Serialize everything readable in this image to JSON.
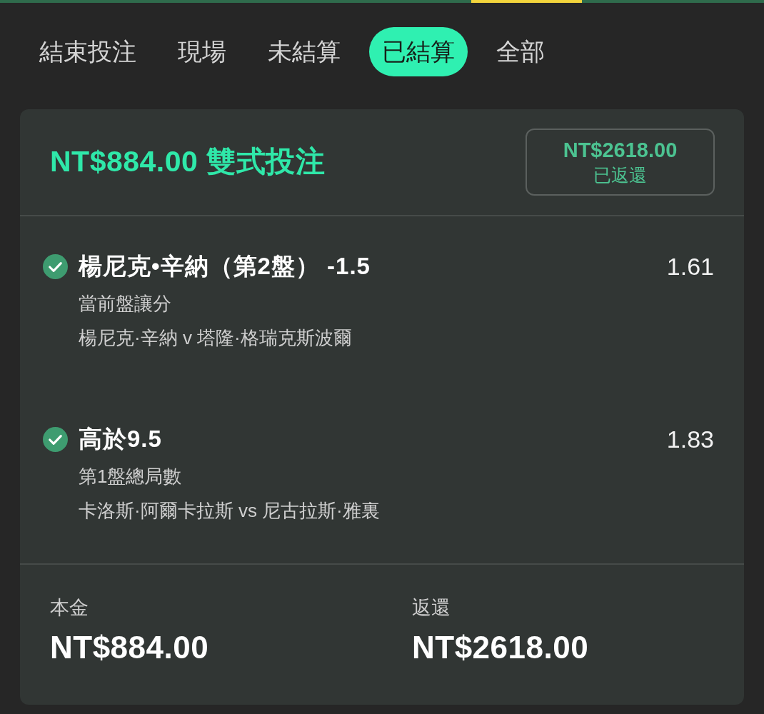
{
  "tabs": [
    {
      "label": "結束投注",
      "selected": false
    },
    {
      "label": "現場",
      "selected": false
    },
    {
      "label": "未結算",
      "selected": false
    },
    {
      "label": "已結算",
      "selected": true
    },
    {
      "label": "全部",
      "selected": false
    }
  ],
  "bet_card": {
    "title": "NT$884.00 雙式投注",
    "status_badge": {
      "amount": "NT$2618.00",
      "label": "已返還"
    },
    "selections": [
      {
        "won": true,
        "selection": "楊尼克•辛納（第2盤） -1.5",
        "odds": "1.61",
        "market": "當前盤讓分",
        "event": "楊尼克·辛納 v 塔隆·格瑞克斯波爾"
      },
      {
        "won": true,
        "selection": "高於9.5",
        "odds": "1.83",
        "market": "第1盤總局數",
        "event": "卡洛斯·阿爾卡拉斯 vs 尼古拉斯·雅裏"
      }
    ],
    "summary": [
      {
        "label": "本金",
        "value": "NT$884.00"
      },
      {
        "label": "返還",
        "value": "NT$2618.00"
      }
    ]
  }
}
